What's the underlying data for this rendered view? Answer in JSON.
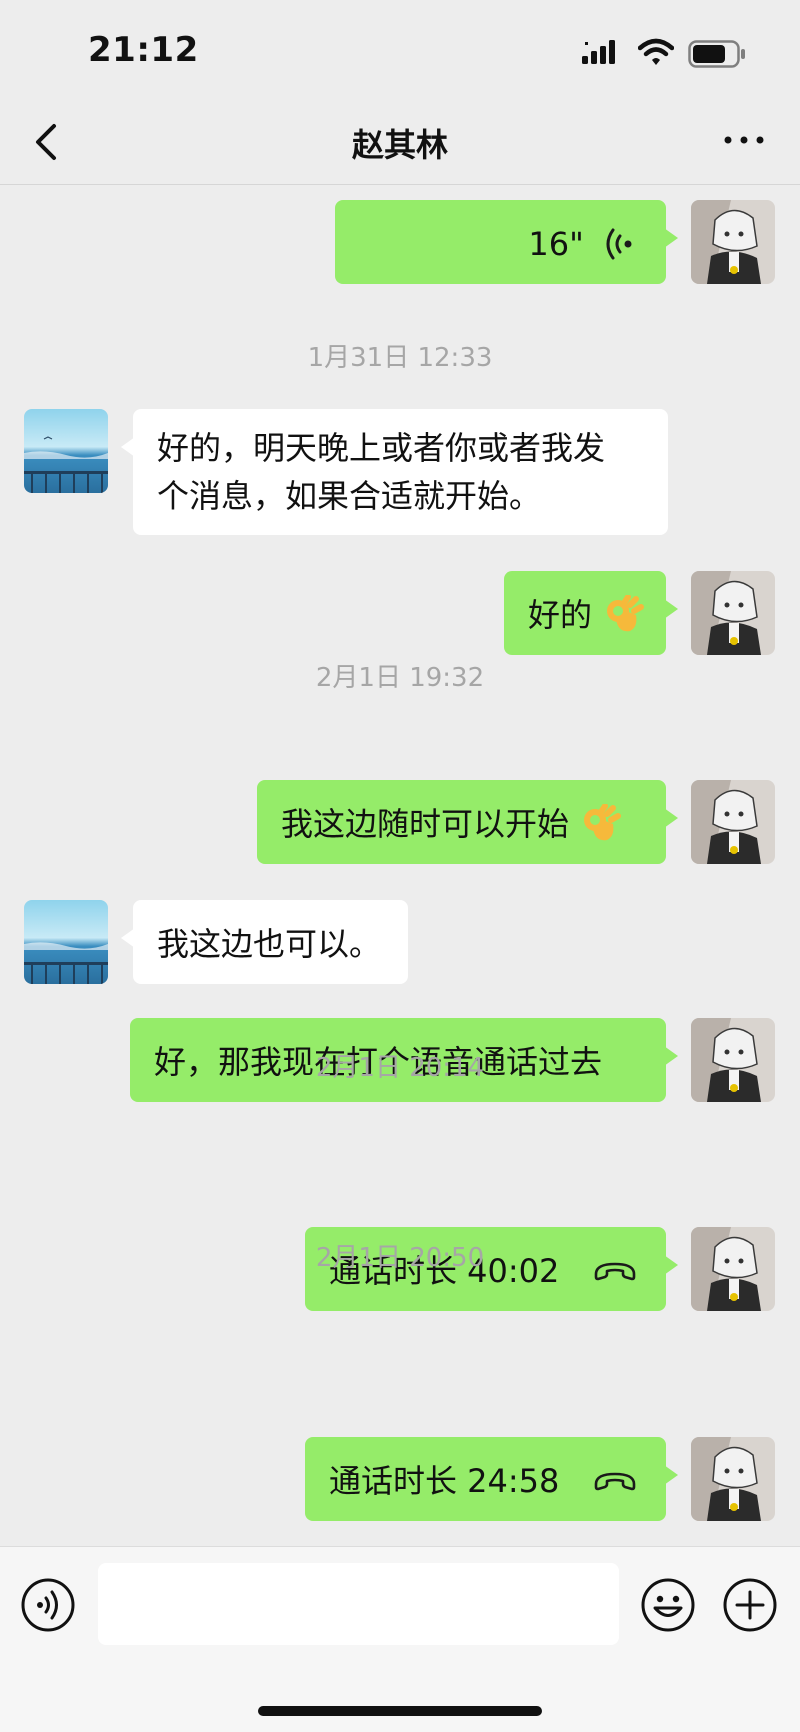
{
  "status_bar": {
    "time": "21:12"
  },
  "header": {
    "title": "赵其林"
  },
  "colors": {
    "self_bubble": "#95ec69",
    "peer_bubble": "#ffffff",
    "background": "#ededed",
    "timestamp": "#a6a6a6"
  },
  "messages": [
    {
      "type": "voice",
      "from": "self",
      "duration": "16\""
    },
    {
      "type": "time",
      "text": "1月31日 12:33"
    },
    {
      "type": "text",
      "from": "peer",
      "lines": [
        "好的，明天晚上或者你或者我发",
        "个消息，如果合适就开始。"
      ]
    },
    {
      "type": "text",
      "from": "self",
      "text": "好的",
      "emoji": "ok-hand-emoji"
    },
    {
      "type": "time",
      "text": "2月1日 19:32"
    },
    {
      "type": "text",
      "from": "self",
      "text": "我这边随时可以开始",
      "emoji": "ok-hand-emoji"
    },
    {
      "type": "text",
      "from": "peer",
      "text": "我这边也可以。"
    },
    {
      "type": "text",
      "from": "self",
      "text": "好，那我现在打个语音通话过去"
    },
    {
      "type": "time",
      "text": "2月1日 20:14"
    },
    {
      "type": "call",
      "from": "self",
      "text": "通话时长 40:02",
      "icon": "phone-hangup-icon"
    },
    {
      "type": "time",
      "text": "2月1日 20:50"
    },
    {
      "type": "call",
      "from": "self",
      "text": "通话时长 24:58",
      "icon": "phone-hangup-icon"
    }
  ],
  "input_bar": {
    "value": "",
    "placeholder": ""
  }
}
